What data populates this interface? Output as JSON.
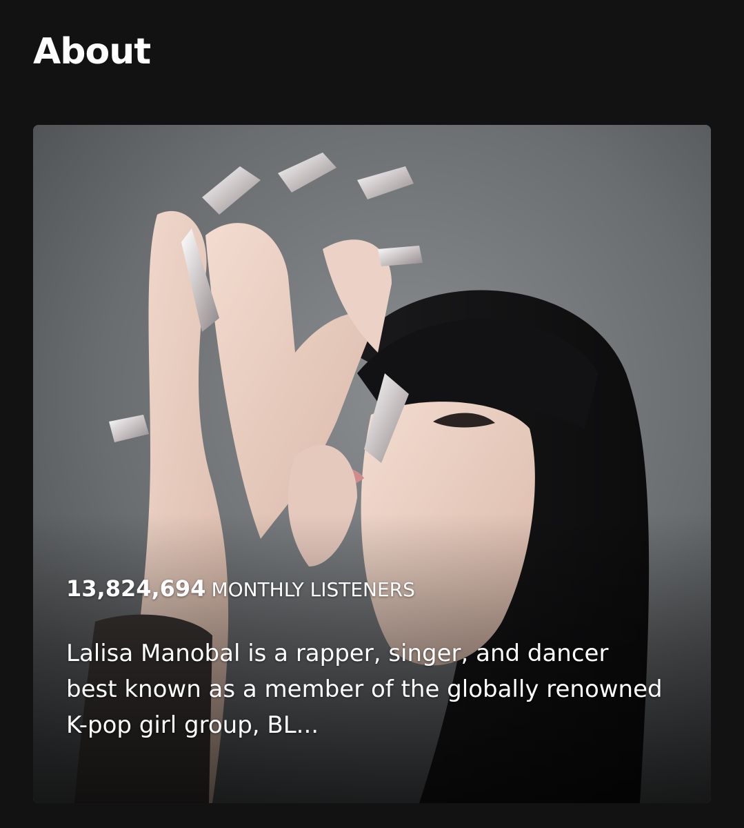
{
  "section": {
    "title": "About"
  },
  "about_card": {
    "monthly_listeners_count": "13,824,694",
    "monthly_listeners_label": "MONTHLY LISTENERS",
    "bio": "Lalisa Manobal is a rapper, singer, and dancer best known as a member of the globally renowned K-pop girl group, BL..."
  },
  "colors": {
    "background": "#121212",
    "text": "#ffffff",
    "photo_backdrop": "#6d7073"
  }
}
